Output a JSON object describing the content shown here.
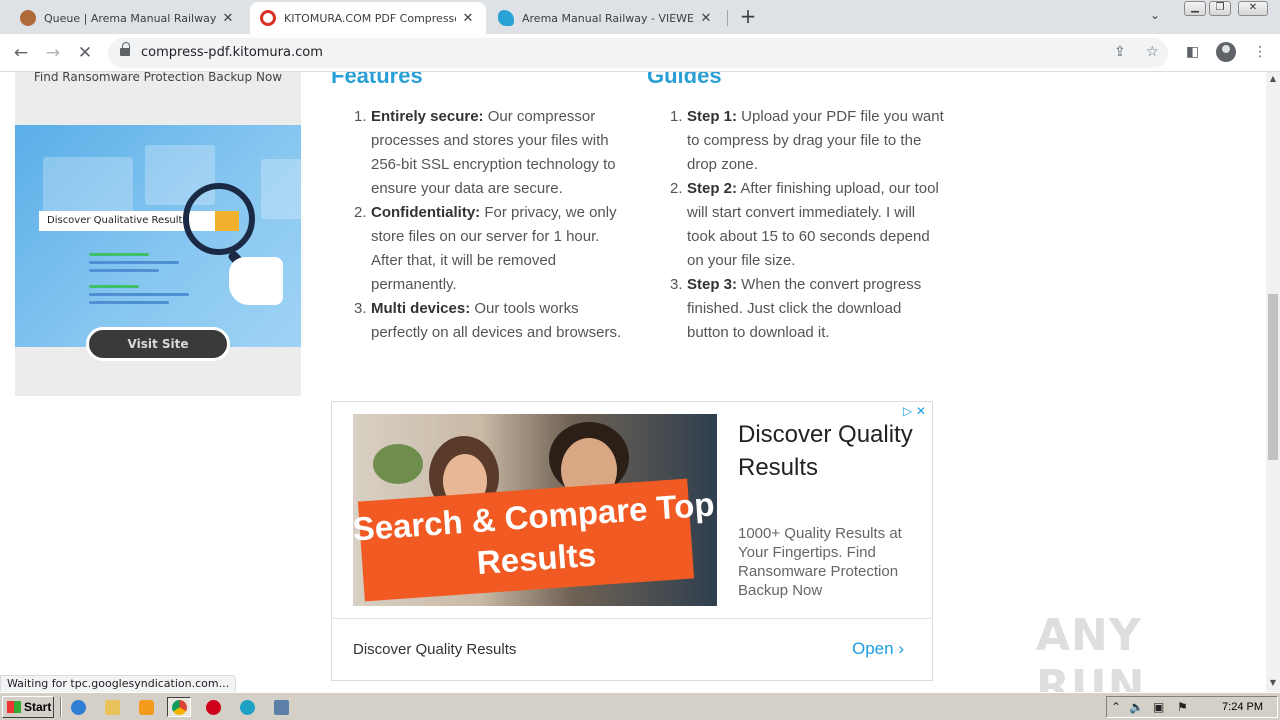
{
  "browser": {
    "tabs": [
      {
        "title": "Queue | Arema Manual Railway - PDF",
        "active": false
      },
      {
        "title": "KITOMURA.COM PDF Compressor Online",
        "active": true
      },
      {
        "title": "Arema Manual Railway - VIEWER XD",
        "active": false
      }
    ],
    "url": "compress-pdf.kitomura.com",
    "status_text": "Waiting for tpc.googlesyndication.com..."
  },
  "left_ad": {
    "caption": "Find Ransomware Protection Backup Now",
    "search_text": "Discover Qualitative Results",
    "button": "Visit Site"
  },
  "features": {
    "title": "Features",
    "items": [
      {
        "num": "1.",
        "label": "Entirely secure:",
        "text": " Our compressor processes and stores your files with 256-bit SSL encryption technology to ensure your data are secure."
      },
      {
        "num": "2.",
        "label": "Confidentiality:",
        "text": " For privacy, we only store files on our server for 1 hour. After that, it will be removed permanently."
      },
      {
        "num": "3.",
        "label": "Multi devices:",
        "text": " Our tools works perfectly on all devices and browsers."
      }
    ]
  },
  "guides": {
    "title": "Guides",
    "items": [
      {
        "num": "1.",
        "label": "Step 1:",
        "text": " Upload your PDF file you want to compress by drag your file to the drop zone."
      },
      {
        "num": "2.",
        "label": "Step 2:",
        "text": " After finishing upload, our tool will start convert immediately. I will took about 15 to 60 seconds depend on your file size."
      },
      {
        "num": "3.",
        "label": "Step 3:",
        "text": " When the convert progress finished. Just click the download button to download it."
      }
    ]
  },
  "ad": {
    "image_text": "Search & Compare Top Results",
    "headline": "Discover Quality Results",
    "body": "1000+ Quality Results at Your Fingertips. Find Ransomware Protection Backup Now",
    "footer_title": "Discover Quality Results",
    "open_label": "Open"
  },
  "watermark": "ANY RUN",
  "taskbar": {
    "start_label": "Start",
    "clock": "7:24 PM"
  },
  "colors": {
    "accent": "#2a9fd6",
    "ad_orange": "#f15a22",
    "link_blue": "#1a9ee2"
  }
}
